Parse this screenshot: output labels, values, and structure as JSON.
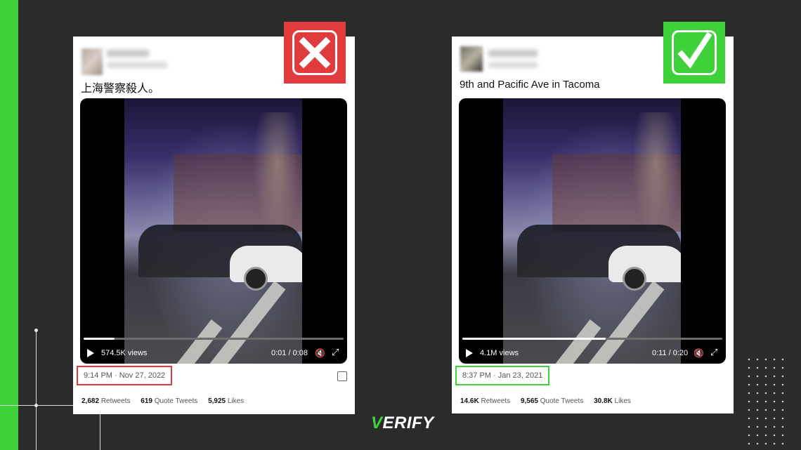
{
  "colors": {
    "accent_green": "#3fd13a",
    "false_red": "#e23b3e",
    "background": "#2b2b2b"
  },
  "left_tweet": {
    "verdict_icon": "x-mark-icon",
    "text": "上海警察殺人。",
    "video": {
      "views": "574.5K views",
      "time": "0:01 / 0:08",
      "progress": 0.12
    },
    "timestamp": "9:14 PM · Nov 27, 2022",
    "stats": {
      "retweets_value": "2,682",
      "retweets_label": "Retweets",
      "quotes_value": "619",
      "quotes_label": "Quote Tweets",
      "likes_value": "5,925",
      "likes_label": "Likes"
    }
  },
  "right_tweet": {
    "verdict_icon": "checkmark-icon",
    "text": "9th and Pacific Ave in Tacoma",
    "video": {
      "views": "4.1M views",
      "time": "0:11 / 0:20",
      "progress": 0.55
    },
    "timestamp": "8:37 PM · Jan 23, 2021",
    "stats": {
      "retweets_value": "14.6K",
      "retweets_label": "Retweets",
      "quotes_value": "9,565",
      "quotes_label": "Quote Tweets",
      "likes_value": "30.8K",
      "likes_label": "Likes"
    }
  },
  "logo": {
    "first_letter": "V",
    "rest": "ERIFY"
  }
}
